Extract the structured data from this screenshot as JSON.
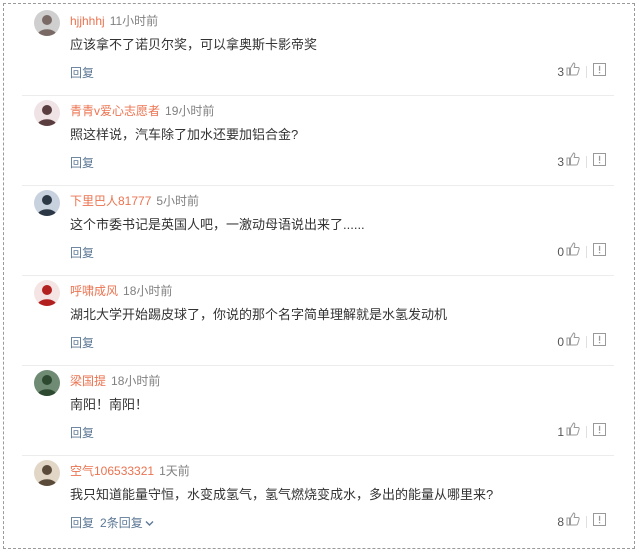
{
  "comments": [
    {
      "username": "hjjhhhj",
      "time": "11小时前",
      "text": "应该拿不了诺贝尔奖，可以拿奥斯卡影帝奖",
      "reply_label": "回复",
      "likes": "3",
      "avatar_colors": [
        "#cfcfcf",
        "#7a6a66"
      ]
    },
    {
      "username": "青青v爱心志愿者",
      "time": "19小时前",
      "text": "照这样说，汽车除了加水还要加铝合金?",
      "reply_label": "回复",
      "likes": "3",
      "avatar_colors": [
        "#efe3e6",
        "#5a3d3f"
      ]
    },
    {
      "username": "下里巴人81777",
      "time": "5小时前",
      "text": "这个市委书记是英国人吧，一激动母语说出来了......",
      "reply_label": "回复",
      "likes": "0",
      "avatar_colors": [
        "#c8d2de",
        "#2c3846"
      ]
    },
    {
      "username": "呼啸成风",
      "time": "18小时前",
      "text": "湖北大学开始踢皮球了，你说的那个名字简单理解就是水氢发动机",
      "reply_label": "回复",
      "likes": "0",
      "avatar_colors": [
        "#f4e4e4",
        "#b2211f"
      ]
    },
    {
      "username": "梁国提",
      "time": "18小时前",
      "text": "南阳！南阳！",
      "reply_label": "回复",
      "likes": "1",
      "avatar_colors": [
        "#6f8b73",
        "#2d4a31"
      ]
    },
    {
      "username": "空气106533321",
      "time": "1天前",
      "text": "我只知道能量守恒，水变成氢气，氢气燃烧变成水，多出的能量从哪里来?",
      "reply_label": "回复",
      "more_replies": "2条回复",
      "likes": "8",
      "avatar_colors": [
        "#e2d6c6",
        "#5a4a3a"
      ]
    }
  ],
  "icons": {
    "like": "thumbs-up-icon",
    "report": "report-icon",
    "expand": "chevron-down-icon"
  },
  "colors": {
    "username": "#eb7350",
    "link": "#5d7895",
    "text": "#333333",
    "muted": "#808080"
  }
}
